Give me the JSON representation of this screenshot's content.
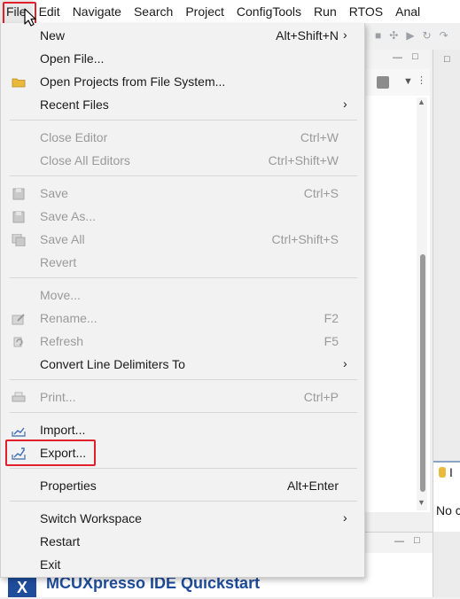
{
  "menubar": {
    "items": [
      "File",
      "Edit",
      "Navigate",
      "Search",
      "Project",
      "ConfigTools",
      "Run",
      "RTOS",
      "Anal"
    ]
  },
  "file_menu": {
    "items": [
      {
        "label": "New",
        "shortcut": "Alt+Shift+N",
        "submenu": true,
        "enabled": true,
        "icon": ""
      },
      {
        "label": "Open File...",
        "shortcut": "",
        "enabled": true,
        "icon": ""
      },
      {
        "label": "Open Projects from File System...",
        "shortcut": "",
        "enabled": true,
        "icon": "folder-icon"
      },
      {
        "label": "Recent Files",
        "shortcut": "",
        "submenu": true,
        "enabled": true,
        "icon": ""
      },
      {
        "label": "Close Editor",
        "shortcut": "Ctrl+W",
        "enabled": false,
        "icon": ""
      },
      {
        "label": "Close All Editors",
        "shortcut": "Ctrl+Shift+W",
        "enabled": false,
        "icon": ""
      },
      {
        "label": "Save",
        "shortcut": "Ctrl+S",
        "enabled": false,
        "icon": "save-icon"
      },
      {
        "label": "Save As...",
        "shortcut": "",
        "enabled": false,
        "icon": "save-as-icon"
      },
      {
        "label": "Save All",
        "shortcut": "Ctrl+Shift+S",
        "enabled": false,
        "icon": "save-all-icon"
      },
      {
        "label": "Revert",
        "shortcut": "",
        "enabled": false,
        "icon": ""
      },
      {
        "label": "Move...",
        "shortcut": "",
        "enabled": false,
        "icon": ""
      },
      {
        "label": "Rename...",
        "shortcut": "F2",
        "enabled": false,
        "icon": "rename-icon"
      },
      {
        "label": "Refresh",
        "shortcut": "F5",
        "enabled": false,
        "icon": "refresh-icon"
      },
      {
        "label": "Convert Line Delimiters To",
        "shortcut": "",
        "submenu": true,
        "enabled": true,
        "icon": ""
      },
      {
        "label": "Print...",
        "shortcut": "Ctrl+P",
        "enabled": false,
        "icon": "print-icon"
      },
      {
        "label": "Import...",
        "shortcut": "",
        "enabled": true,
        "icon": "import-icon"
      },
      {
        "label": "Export...",
        "shortcut": "",
        "enabled": true,
        "icon": "export-icon"
      },
      {
        "label": "Properties",
        "shortcut": "Alt+Enter",
        "enabled": true,
        "icon": ""
      },
      {
        "label": "Switch Workspace",
        "shortcut": "",
        "submenu": true,
        "enabled": true,
        "icon": ""
      },
      {
        "label": "Restart",
        "shortcut": "",
        "enabled": true,
        "icon": ""
      },
      {
        "label": "Exit",
        "shortcut": "",
        "enabled": true,
        "icon": ""
      }
    ]
  },
  "background": {
    "quickstart_title": "MCUXpresso IDE Quickstart",
    "right_panel_text": "No c",
    "right_panel_tab_label": "I"
  },
  "colors": {
    "highlight_outline": "#e0202a",
    "brand_blue": "#1f4d9c"
  }
}
